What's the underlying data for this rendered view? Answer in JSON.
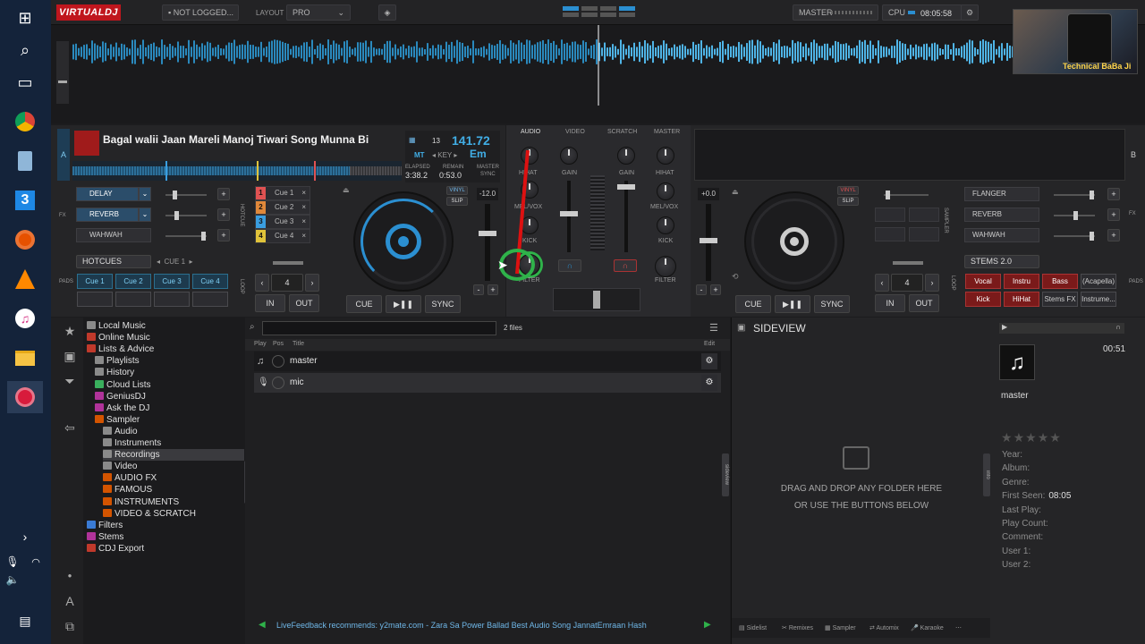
{
  "taskbar": {
    "icons": [
      "windows-icon",
      "search-icon",
      "task-view-icon",
      "chrome-icon",
      "recycle-bin-icon",
      "app-3-icon",
      "record-icon",
      "vlc-icon",
      "itunes-icon",
      "file-explorer-icon",
      "virtualdj-icon",
      "chevron-right-icon",
      "microphone-icon",
      "network-icon",
      "volume-icon",
      "notification-icon"
    ]
  },
  "topbar": {
    "logo": "VIRTUALDJ",
    "login": "NOT LOGGED...",
    "layout_label": "LAYOUT",
    "layout_value": "PRO",
    "master_label": "MASTER",
    "cpu_label": "CPU",
    "clock": "08:05:58"
  },
  "webcam": {
    "caption": "Technical BaBa Ji"
  },
  "deck_a": {
    "letter": "A",
    "title": "Bagal walii Jaan Mareli  Manoj Tiwari Song  Munna Bi",
    "mt": "MT",
    "key_number": "13",
    "bpm": "141.72",
    "key_label": "KEY",
    "key": "Em",
    "elapsed_label": "ELAPSED",
    "elapsed": "3:38.2",
    "remain_label": "REMAIN",
    "remain": "0:53.0",
    "master_label": "MASTER",
    "sync_label": "SYNC",
    "fx": [
      {
        "label": "DELAY",
        "on": true
      },
      {
        "label": "REVERB",
        "on": true
      },
      {
        "label": "WAHWAH",
        "on": false
      }
    ],
    "fx_side_label": "FX",
    "hotcue_side_label": "HOTCUE",
    "cues": [
      {
        "n": "1",
        "label": "Cue 1",
        "color": "#e05252"
      },
      {
        "n": "2",
        "label": "Cue 2",
        "color": "#e0883a"
      },
      {
        "n": "3",
        "label": "Cue 3",
        "color": "#3a9ee0"
      },
      {
        "n": "4",
        "label": "Cue 4",
        "color": "#e0c33a"
      }
    ],
    "pads_side_label": "PADS",
    "pads_mode": "HOTCUES",
    "pads_page": "CUE 1",
    "pads": [
      "Cue 1",
      "Cue 2",
      "Cue 3",
      "Cue 4"
    ],
    "loop_side_label": "LOOP",
    "loop_size": "4",
    "in": "IN",
    "out": "OUT",
    "vinyl": "VINYL",
    "slip": "SLIP",
    "pitch": "-12.0",
    "cue": "CUE",
    "play": "▶❚❚",
    "sync": "SYNC"
  },
  "deck_b": {
    "letter": "B",
    "pitch": "+0.0",
    "vinyl": "VINYL",
    "slip": "SLIP",
    "fx": [
      "FLANGER",
      "REVERB",
      "WAHWAH"
    ],
    "fx_side_label": "FX",
    "sampler_side_label": "SAMPLER",
    "loop_size": "4",
    "in": "IN",
    "out": "OUT",
    "loop_side_label": "LOOP",
    "cue": "CUE",
    "play": "▶❚❚",
    "sync": "SYNC",
    "stems_mode": "STEMS 2.0",
    "pads_side_label": "PADS",
    "stems": [
      {
        "label": "Vocal",
        "red": true
      },
      {
        "label": "Instru",
        "red": true
      },
      {
        "label": "Bass",
        "red": true
      },
      {
        "label": "(Acapella)",
        "red": false
      },
      {
        "label": "Kick",
        "red": true
      },
      {
        "label": "HiHat",
        "red": true
      },
      {
        "label": "Stems FX",
        "red": false
      },
      {
        "label": "Instrume...",
        "red": false
      }
    ]
  },
  "mixer": {
    "tabs": [
      "AUDIO",
      "VIDEO",
      "SCRATCH",
      "MASTER"
    ],
    "left_labels": [
      "HIHAT",
      "MELVOX",
      "KICK",
      "FILTER"
    ],
    "gain": "GAIN",
    "right_labels": [
      "HIHAT",
      "MEL/VOX",
      "KICK",
      "FILTER"
    ],
    "left_melvox": "MEL/VOX"
  },
  "browser": {
    "search_placeholder": "",
    "file_count": "2 files",
    "columns": {
      "play": "Play",
      "pos": "Pos",
      "title": "Title",
      "edit": "Edit"
    },
    "files": [
      "master",
      "mic"
    ],
    "folders": [
      {
        "label": "Local Music",
        "level": 0,
        "color": "#8a8a8a"
      },
      {
        "label": "Online Music",
        "level": 0,
        "color": "#c0392b"
      },
      {
        "label": "Lists & Advice",
        "level": 0,
        "color": "#c0392b"
      },
      {
        "label": "Playlists",
        "level": 1,
        "color": "#8a8a8a"
      },
      {
        "label": "History",
        "level": 1,
        "color": "#8a8a8a"
      },
      {
        "label": "Cloud Lists",
        "level": 1,
        "color": "#3aaf5d"
      },
      {
        "label": "GeniusDJ",
        "level": 1,
        "color": "#b0339a"
      },
      {
        "label": "Ask the DJ",
        "level": 1,
        "color": "#b0339a"
      },
      {
        "label": "Sampler",
        "level": 1,
        "color": "#d35400"
      },
      {
        "label": "Audio",
        "level": 2,
        "color": "#8a8a8a"
      },
      {
        "label": "Instruments",
        "level": 2,
        "color": "#8a8a8a"
      },
      {
        "label": "Recordings",
        "level": 2,
        "color": "#8a8a8a",
        "selected": true
      },
      {
        "label": "Video",
        "level": 2,
        "color": "#8a8a8a"
      },
      {
        "label": "AUDIO FX",
        "level": 2,
        "color": "#d35400"
      },
      {
        "label": "FAMOUS",
        "level": 2,
        "color": "#d35400"
      },
      {
        "label": "INSTRUMENTS",
        "level": 2,
        "color": "#d35400"
      },
      {
        "label": "VIDEO & SCRATCH",
        "level": 2,
        "color": "#d35400"
      },
      {
        "label": "Filters",
        "level": 0,
        "color": "#3a7bd5"
      },
      {
        "label": "Stems",
        "level": 0,
        "color": "#b0339a"
      },
      {
        "label": "CDJ Export",
        "level": 0,
        "color": "#c0392b"
      }
    ],
    "folders_tab": "folders",
    "sideview_title": "SIDEVIEW",
    "sideview_tab": "sideview",
    "drop_line1": "DRAG AND DROP ANY FOLDER HERE",
    "drop_line2": "OR USE THE BUTTONS BELOW",
    "bottom_tabs": [
      "Sidelist",
      "Remixes",
      "Sampler",
      "Automix",
      "Karaoke"
    ],
    "livefeedback": "LiveFeedback recommends: y2mate.com - Zara Sa Power Ballad Best Audio Song JannatEmraan Hash"
  },
  "info": {
    "time": "00:51",
    "title": "master",
    "tab": "info",
    "fields": [
      {
        "label": "Year:",
        "value": ""
      },
      {
        "label": "Album:",
        "value": ""
      },
      {
        "label": "Genre:",
        "value": ""
      },
      {
        "label": "First Seen:",
        "value": "08:05"
      },
      {
        "label": "Last Play:",
        "value": ""
      },
      {
        "label": "Play Count:",
        "value": ""
      },
      {
        "label": "Comment:",
        "value": ""
      },
      {
        "label": "User 1:",
        "value": ""
      },
      {
        "label": "User 2:",
        "value": ""
      }
    ]
  }
}
